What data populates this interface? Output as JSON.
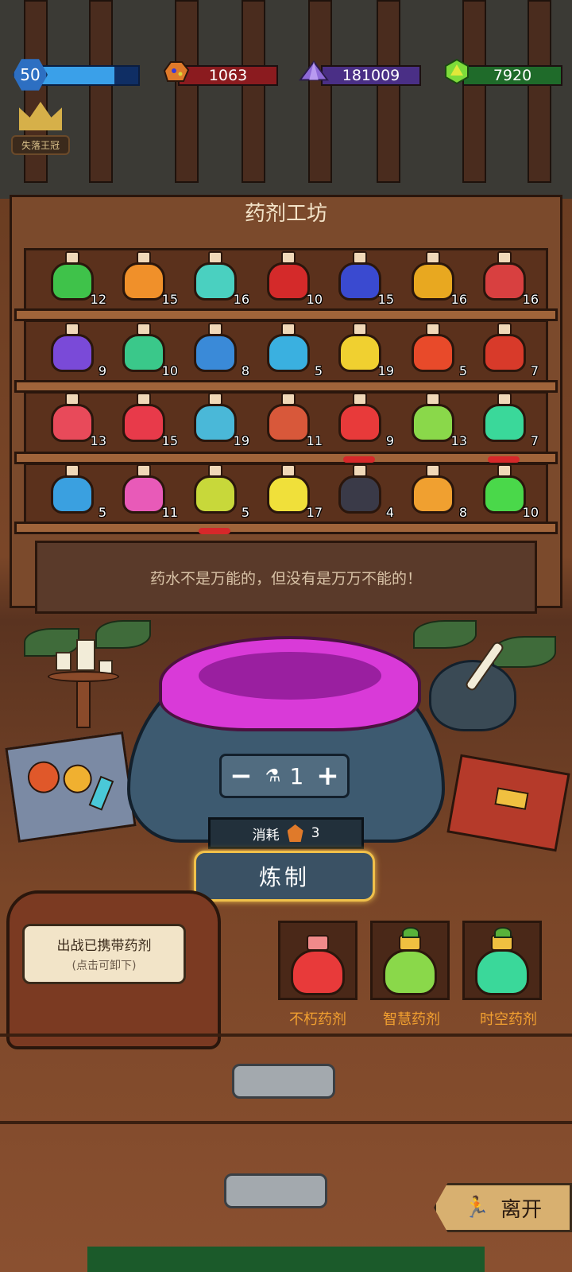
{
  "hud": {
    "level": "50",
    "xp_fill": 0.76,
    "resources": [
      {
        "name": "orange-ore",
        "value": "1063",
        "color": "#8b1b1f",
        "icon_color": "#e07a2a"
      },
      {
        "name": "purple-crystal",
        "value": "181009",
        "color": "#4a2f86",
        "icon_color": "#8e6ad8"
      },
      {
        "name": "green-gem",
        "value": "7920",
        "color": "#1f6b2a",
        "icon_color": "#7ddb3a"
      }
    ],
    "crown_label": "失落王冠"
  },
  "workshop": {
    "title": "药剂工坊",
    "quote": "药水不是万能的，但没有是万万不能的！"
  },
  "shelves": [
    [
      {
        "count": "12",
        "color": "#3fc24a",
        "equipped": false
      },
      {
        "count": "15",
        "color": "#f0902a",
        "equipped": false
      },
      {
        "count": "16",
        "color": "#4ad0c0",
        "equipped": false
      },
      {
        "count": "10",
        "color": "#d42a2a",
        "equipped": false
      },
      {
        "count": "15",
        "color": "#3a4ad0",
        "equipped": false
      },
      {
        "count": "16",
        "color": "#e8a820",
        "equipped": false
      },
      {
        "count": "16",
        "color": "#d84040",
        "equipped": false
      }
    ],
    [
      {
        "count": "9",
        "color": "#7a4ad8",
        "equipped": false
      },
      {
        "count": "10",
        "color": "#3ac88a",
        "equipped": false
      },
      {
        "count": "8",
        "color": "#3a8ad8",
        "equipped": false
      },
      {
        "count": "5",
        "color": "#3ab0e0",
        "equipped": false
      },
      {
        "count": "19",
        "color": "#f0d030",
        "equipped": false
      },
      {
        "count": "5",
        "color": "#e84a2a",
        "equipped": false
      },
      {
        "count": "7",
        "color": "#d83a2a",
        "equipped": false
      }
    ],
    [
      {
        "count": "13",
        "color": "#e84a5a",
        "equipped": false
      },
      {
        "count": "15",
        "color": "#e83a4a",
        "equipped": false
      },
      {
        "count": "19",
        "color": "#4ab8d8",
        "equipped": false
      },
      {
        "count": "11",
        "color": "#d8583a",
        "equipped": false
      },
      {
        "count": "9",
        "color": "#e83a3a",
        "equipped": true
      },
      {
        "count": "13",
        "color": "#8ad84a",
        "equipped": false
      },
      {
        "count": "7",
        "color": "#3ad89a",
        "equipped": true
      }
    ],
    [
      {
        "count": "5",
        "color": "#3aa0e0",
        "equipped": false
      },
      {
        "count": "11",
        "color": "#e85ab8",
        "equipped": false
      },
      {
        "count": "5",
        "color": "#c8d83a",
        "equipped": true
      },
      {
        "count": "17",
        "color": "#f0e03a",
        "equipped": false
      },
      {
        "count": "4",
        "color": "#3a3a48",
        "equipped": false
      },
      {
        "count": "8",
        "color": "#f0a030",
        "equipped": false
      },
      {
        "count": "10",
        "color": "#4ad84a",
        "equipped": false
      }
    ]
  ],
  "brew": {
    "minus": "−",
    "plus": "+",
    "quantity": "1",
    "cost_label": "消耗",
    "cost_value": "3",
    "button": "炼制"
  },
  "bag": {
    "title": "出战已携带药剂",
    "hint": "(点击可卸下)"
  },
  "carried": [
    {
      "label": "不朽药剂",
      "color": "#e83a3a",
      "sprout": false
    },
    {
      "label": "智慧药剂",
      "color": "#8ad84a",
      "sprout": true
    },
    {
      "label": "时空药剂",
      "color": "#3ad89a",
      "sprout": true
    }
  ],
  "leave": {
    "label": "离开",
    "icon": "running-man-icon"
  }
}
